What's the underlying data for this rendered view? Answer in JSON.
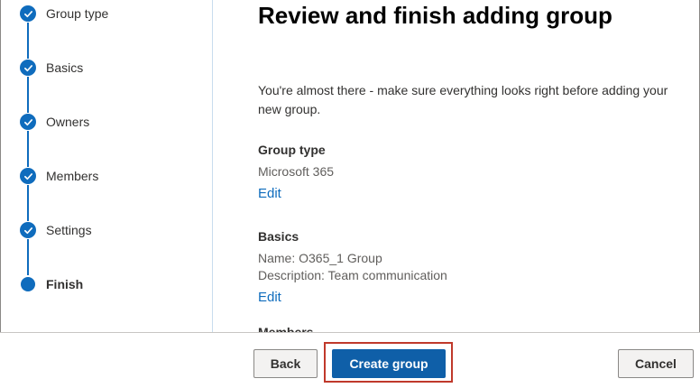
{
  "wizard": {
    "steps": [
      {
        "label": "Group type",
        "state": "completed"
      },
      {
        "label": "Basics",
        "state": "completed"
      },
      {
        "label": "Owners",
        "state": "completed"
      },
      {
        "label": "Members",
        "state": "completed"
      },
      {
        "label": "Settings",
        "state": "completed"
      },
      {
        "label": "Finish",
        "state": "current"
      }
    ],
    "accent_color": "#0f6cbd"
  },
  "main": {
    "title": "Review and finish adding group",
    "intro": "You're almost there - make sure everything looks right before adding your new group.",
    "sections": [
      {
        "heading": "Group type",
        "lines": [
          "Microsoft 365"
        ],
        "edit_label": "Edit"
      },
      {
        "heading": "Basics",
        "lines": [
          "Name: O365_1 Group",
          "Description: Team communication"
        ],
        "edit_label": "Edit"
      },
      {
        "heading": "Members",
        "lines": [],
        "edit_label": ""
      }
    ]
  },
  "footer": {
    "back_label": "Back",
    "create_label": "Create group",
    "cancel_label": "Cancel",
    "highlight_color": "#c0392b"
  }
}
